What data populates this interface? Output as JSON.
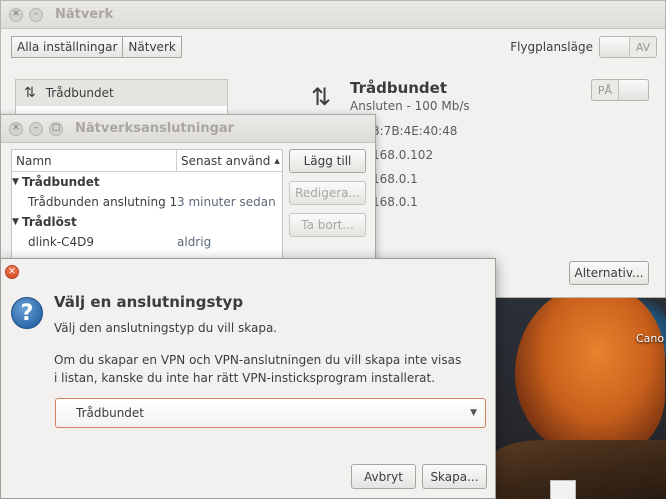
{
  "network_window": {
    "title": "Nätverk",
    "toolbar": {
      "all_settings": "Alla inställningar",
      "network": "Nätverk"
    },
    "airplane_mode": {
      "label": "Flygplansläge",
      "state": "AV"
    },
    "sidebar": {
      "items": [
        {
          "label": "Trådbundet",
          "icon": "wired-network-icon"
        }
      ]
    },
    "detail": {
      "title": "Trådbundet",
      "status": "Ansluten - 100 Mb/s",
      "switch_state": "PÅ",
      "rows": [
        "3:7B:4E:40:48",
        "168.0.102",
        "168.0.1",
        "168.0.1"
      ],
      "options_button": "Alternativ..."
    }
  },
  "connections_window": {
    "title": "Nätverksanslutningar",
    "columns": {
      "name": "Namn",
      "last_used": "Senast använd"
    },
    "groups": [
      {
        "name": "Trådbundet",
        "items": [
          {
            "name": "Trådbunden anslutning 1",
            "last_used": "3 minuter sedan"
          }
        ]
      },
      {
        "name": "Trådlöst",
        "items": [
          {
            "name": "dlink-C4D9",
            "last_used": "aldrig"
          }
        ]
      }
    ],
    "buttons": {
      "add": "Lägg till",
      "edit": "Redigera...",
      "delete": "Ta bort..."
    }
  },
  "dialog": {
    "title": "Välj en anslutningstyp",
    "text1": "Välj den anslutningstyp du vill skapa.",
    "text2": "Om du skapar en VPN och VPN-anslutningen du vill skapa inte visas i listan, kanske du inte har rätt VPN-insticksprogram installerat.",
    "combo_value": "Trådbundet",
    "buttons": {
      "cancel": "Avbryt",
      "create": "Skapa..."
    }
  },
  "desktop": {
    "label": "Cano"
  }
}
